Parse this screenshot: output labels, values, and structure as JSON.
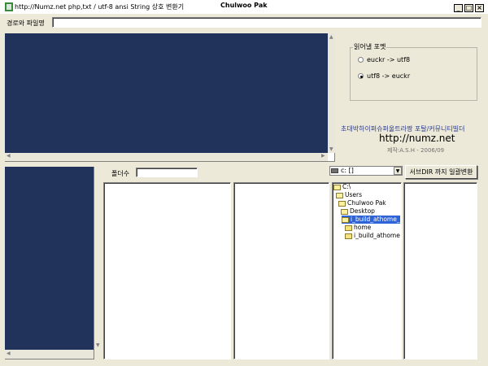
{
  "window": {
    "title_url": "http://Numz.net  php,txt  / utf-8 ansi String 상호 변환기",
    "title_name": "Chulwoo Pak",
    "minimize_glyph": "_",
    "maximize_glyph": "□",
    "close_glyph": "×"
  },
  "path": {
    "label": "경로와 파일명",
    "value": ""
  },
  "format": {
    "title": "읽어낼 포멧",
    "options": [
      {
        "label": "euckr -> utf8",
        "selected": false
      },
      {
        "label": "utf8 -> euckr",
        "selected": true
      }
    ]
  },
  "branding": {
    "tagline": "초대박하이퍼슈퍼울트라짱 포탈/커뮤니티빌더",
    "url": "http://numz.net",
    "credit": "제작:A.S.H - 2006/09"
  },
  "count": {
    "label": "폴더수",
    "value": ""
  },
  "drive": {
    "selected": "c: []"
  },
  "convert_button": "서브DIR 까지 일괄변환",
  "directories": [
    {
      "name": "C:\\"
    },
    {
      "name": "Users"
    },
    {
      "name": "Chulwoo Pak"
    },
    {
      "name": "Desktop"
    },
    {
      "name": "i_build_athome_v"
    },
    {
      "name": "home"
    },
    {
      "name": "i_build_athome"
    }
  ],
  "colors": {
    "panel_navy": "#21335a",
    "window_bg": "#ece9d8",
    "tagline": "#2c3c8c",
    "selection": "#2e63d8"
  }
}
